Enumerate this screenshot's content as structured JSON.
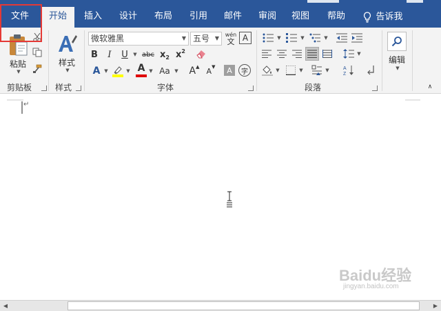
{
  "tabs": [
    {
      "label": "文件",
      "active": false
    },
    {
      "label": "开始",
      "active": true
    },
    {
      "label": "插入",
      "active": false
    },
    {
      "label": "设计",
      "active": false
    },
    {
      "label": "布局",
      "active": false
    },
    {
      "label": "引用",
      "active": false
    },
    {
      "label": "邮件",
      "active": false
    },
    {
      "label": "审阅",
      "active": false
    },
    {
      "label": "视图",
      "active": false
    },
    {
      "label": "帮助",
      "active": false
    }
  ],
  "tell_me": {
    "label": "告诉我",
    "icon": "lightbulb-icon"
  },
  "clipboard": {
    "paste_label": "粘贴",
    "group_label": "剪贴板"
  },
  "styles": {
    "button_label": "样式",
    "group_label": "样式"
  },
  "font": {
    "name": "微软雅黑",
    "size": "五号",
    "group_label": "字体",
    "bold": "B",
    "italic": "I",
    "underline": "U",
    "strike": "abc",
    "subscript_base": "x",
    "subscript": "2",
    "superscript_base": "x",
    "superscript": "2",
    "phonetic_top": "wén",
    "phonetic_bottom": "文",
    "border_char": "A",
    "text_effects": "A",
    "font_color": "A",
    "change_case": "Aa",
    "grow": "A",
    "shrink": "A",
    "shading_char": "A",
    "enclose_char": "字",
    "highlight_color": "#ffff00",
    "font_color_value": "#e00000"
  },
  "paragraph": {
    "group_label": "段落"
  },
  "editing": {
    "label": "编辑"
  },
  "document": {
    "paragraph_mark": "↵"
  },
  "accent_color": "#2b579a",
  "watermark": {
    "text": "Baidu经验",
    "url": "jingyan.baidu.com"
  }
}
